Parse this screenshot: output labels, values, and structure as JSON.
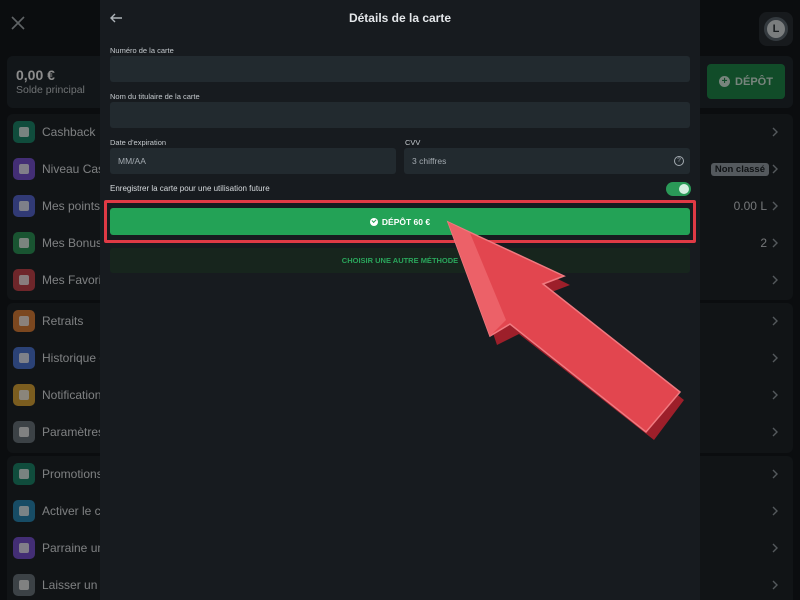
{
  "background": {
    "balance": {
      "amount": "0,00 €",
      "label": "Solde principal"
    },
    "deposit_button": "DÉPÔT",
    "avatar_letter": "L",
    "menu": [
      {
        "label": "Cashback",
        "icon": "piggy-bank-icon",
        "color": "#1e8a6e"
      },
      {
        "label": "Niveau Cas",
        "icon": "level-icon",
        "color": "#7b55d6",
        "badge": "Non classé"
      },
      {
        "label": "Mes points",
        "icon": "points-icon",
        "color": "#5a6ad6",
        "value": "0.00 L"
      },
      {
        "label": "Mes Bonus",
        "icon": "gift-icon",
        "color": "#2f9a5a",
        "value": "2"
      },
      {
        "label": "Mes Favoris",
        "icon": "heart-icon",
        "color": "#c8464e"
      },
      {
        "label": "Retraits",
        "icon": "upload-icon",
        "color": "#e0813a"
      },
      {
        "label": "Historique d",
        "icon": "clock-icon",
        "color": "#4f79d8"
      },
      {
        "label": "Notification",
        "icon": "bell-icon",
        "color": "#e0a93a"
      },
      {
        "label": "Paramètres",
        "icon": "gear-icon",
        "color": "#6e7880"
      },
      {
        "label": "Promotions",
        "icon": "promo-icon",
        "color": "#1e8a6e"
      },
      {
        "label": "Activer le c",
        "icon": "ticket-icon",
        "color": "#2b8bb8"
      },
      {
        "label": "Parraine un",
        "icon": "referral-icon",
        "color": "#7b55d6"
      },
      {
        "label": "Laisser un c",
        "icon": "chat-icon",
        "color": "#6e7880"
      }
    ]
  },
  "modal": {
    "title": "Détails de la carte",
    "card_number_label": "Numéro de la carte",
    "card_number_value": "",
    "holder_label": "Nom du titulaire de la carte",
    "holder_value": "",
    "expiry_label": "Date d'expiration",
    "expiry_placeholder": "MM/AA",
    "cvv_label": "CVV",
    "cvv_placeholder": "3 chiffres",
    "save_card_label": "Enregistrer la carte pour une utilisation future",
    "save_card_on": true,
    "deposit_label": "DÉPÔT 60 €",
    "other_method_label": "CHOISIR UNE AUTRE MÉTHODE"
  },
  "colors": {
    "accent_green": "#23a256",
    "highlight_red": "#e03a45"
  }
}
